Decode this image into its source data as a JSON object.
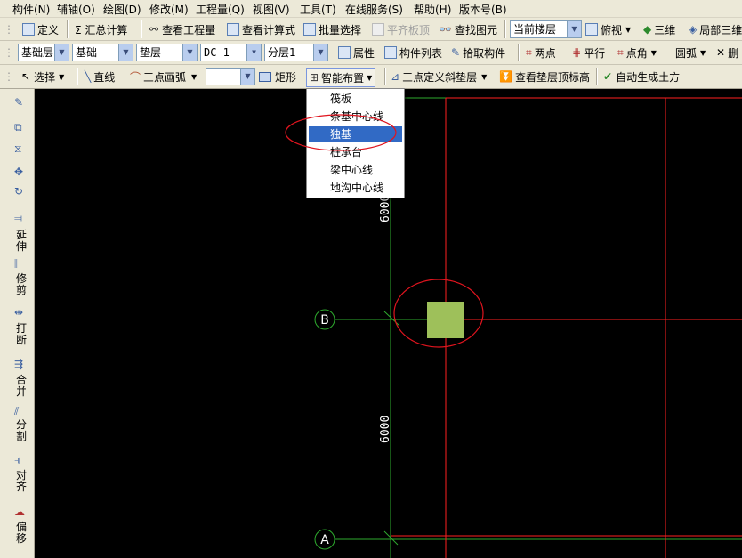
{
  "menubar": {
    "items": [
      "构件(N)",
      "辅轴(O)",
      "绘图(D)",
      "修改(M)",
      "工程量(Q)",
      "视图(V)",
      "工具(T)",
      "在线服务(S)",
      "帮助(H)",
      "版本号(B)"
    ]
  },
  "toolbar1": {
    "define": "定义",
    "summary_calc": "Σ 汇总计算",
    "view_quantity": "查看工程量",
    "view_formula": "查看计算式",
    "batch_select": "批量选择",
    "flush_slab_top": "平齐板顶",
    "find_element": "查找图元",
    "floor_scope": "当前楼层",
    "top_view": "俯视",
    "three_d": "三维",
    "local_3d": "局部三维"
  },
  "toolbar2": {
    "floor": "基础层",
    "category": "基础",
    "type": "垫层",
    "component": "DC-1",
    "layer": "分层1",
    "properties": "属性",
    "component_list": "构件列表",
    "pick_component": "拾取构件",
    "two_points": "两点",
    "parallel": "平行",
    "point_angle": "点角",
    "arc": "圆弧",
    "delete": "删"
  },
  "toolbar3": {
    "select": "选择",
    "line": "直线",
    "three_point_arc": "三点画弧",
    "arc_value": "",
    "rectangle": "矩形",
    "smart_place": "智能布置",
    "three_point_slope": "三点定义斜垫层",
    "view_top_elevation": "查看垫层顶标高",
    "auto_earthwork": "自动生成土方"
  },
  "dropdown": {
    "items": [
      "筏板",
      "条基中心线",
      "独基",
      "桩承台",
      "梁中心线",
      "地沟中心线"
    ],
    "selected_index": 2
  },
  "left_toolbar": {
    "extend": "延伸",
    "trim": "修剪",
    "break": "打断",
    "merge": "合并",
    "split": "分割",
    "align": "对齐",
    "offset": "偏移"
  },
  "canvas": {
    "axis_labels": [
      "B",
      "A"
    ],
    "dimensions": [
      "6000",
      "6000"
    ],
    "colors": {
      "background": "#000000",
      "grid_red": "#ff2020",
      "axis_green": "#2eaa2e",
      "element": "#9ec05a",
      "highlight_circle": "#e0141e"
    }
  }
}
